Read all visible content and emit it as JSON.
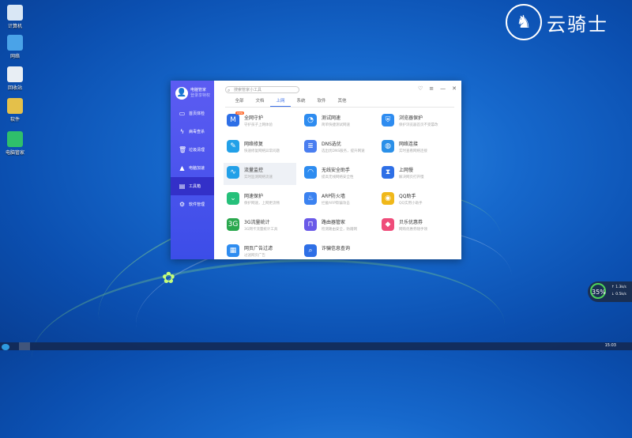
{
  "desktop": {
    "icons": [
      {
        "label": "计算机",
        "icon": "computer-icon",
        "color": "#d9e7f5"
      },
      {
        "label": "网络",
        "icon": "network-icon",
        "color": "#4aa3e8"
      },
      {
        "label": "回收站",
        "icon": "recycle-bin-icon",
        "color": "#e8eef4"
      },
      {
        "label": "软件",
        "icon": "software-folder-icon",
        "color": "#e4c04a"
      },
      {
        "label": "电脑管家",
        "icon": "guard-icon",
        "color": "#2fbf6b"
      }
    ],
    "brand_text": "云骑士"
  },
  "app": {
    "profile": {
      "name": "电脑管家",
      "subtitle": "登录享特权"
    },
    "sidebar": [
      {
        "label": "首页体检",
        "icon": "monitor-icon"
      },
      {
        "label": "病毒查杀",
        "icon": "lightning-icon"
      },
      {
        "label": "垃圾清理",
        "icon": "trash-icon"
      },
      {
        "label": "电脑加速",
        "icon": "rocket-icon"
      },
      {
        "label": "工具箱",
        "icon": "toolbox-icon",
        "active": true
      },
      {
        "label": "软件管理",
        "icon": "apps-icon"
      }
    ],
    "search_placeholder": "搜索管家小工具",
    "tabs": [
      "全部",
      "文档",
      "上网",
      "系统",
      "软件",
      "其他"
    ],
    "active_tab": "上网",
    "tools": [
      {
        "name": "全网守护",
        "desc": "守护孩子上网体验",
        "icon": "shield-m-icon",
        "color": "#2e6fe6",
        "badge": "new"
      },
      {
        "name": "测试网速",
        "desc": "简单快捷测试网速",
        "icon": "speedometer-icon",
        "color": "#2e8cf0"
      },
      {
        "name": "浏览器保护",
        "desc": "保护浏览器首页不受篡改",
        "icon": "browser-shield-icon",
        "color": "#2e8cf0"
      },
      {
        "name": "网络修复",
        "desc": "快速修复网络异常问题",
        "icon": "wrench-icon",
        "color": "#22a0e8"
      },
      {
        "name": "DNS选优",
        "desc": "选出优DNS服务，提升网速",
        "icon": "dns-icon",
        "color": "#4a7ef0"
      },
      {
        "name": "网络连接",
        "desc": "实时查看网络连接",
        "icon": "globe-icon",
        "color": "#2b90e8"
      },
      {
        "name": "流量监控",
        "desc": "实时监测网络流速",
        "icon": "traffic-monitor-icon",
        "color": "#22a0e8"
      },
      {
        "name": "无线安全助手",
        "desc": "提高无线网络安全性",
        "icon": "wifi-icon",
        "color": "#2e8cf0"
      },
      {
        "name": "上网慢",
        "desc": "解决网页打开慢",
        "icon": "hourglass-icon",
        "color": "#2e6fe6"
      },
      {
        "name": "网速保护",
        "desc": "保护网速，上网更流畅",
        "icon": "shield-down-icon",
        "color": "#26c07a"
      },
      {
        "name": "ARP防火墙",
        "desc": "拦截ARP欺骗攻击",
        "icon": "fire-icon",
        "color": "#3b82f0"
      },
      {
        "name": "QQ助手",
        "desc": "QQ实用小助手",
        "icon": "qq-icon",
        "color": "#f0b81a"
      },
      {
        "name": "3G流量统计",
        "desc": "3G网卡流量统计工具",
        "icon": "3g-icon",
        "color": "#2aa84e"
      },
      {
        "name": "路由器管家",
        "desc": "检测路由安全，防蹭网",
        "icon": "router-icon",
        "color": "#6a5ae8"
      },
      {
        "name": "贝乐优惠券",
        "desc": "网购优惠券随手领",
        "icon": "coupon-icon",
        "color": "#ef4c7a"
      },
      {
        "name": "网页广告过滤",
        "desc": "过滤网页广告",
        "icon": "ad-filter-icon",
        "color": "#2e8cf0"
      },
      {
        "name": "诈骗信息查询",
        "desc": "",
        "icon": "fraud-search-icon",
        "color": "#2e6fe6"
      }
    ]
  },
  "widget": {
    "percent": "35%",
    "up": "1.3k/s",
    "down": "0.5k/s"
  },
  "taskbar": {
    "time": "15:03"
  }
}
